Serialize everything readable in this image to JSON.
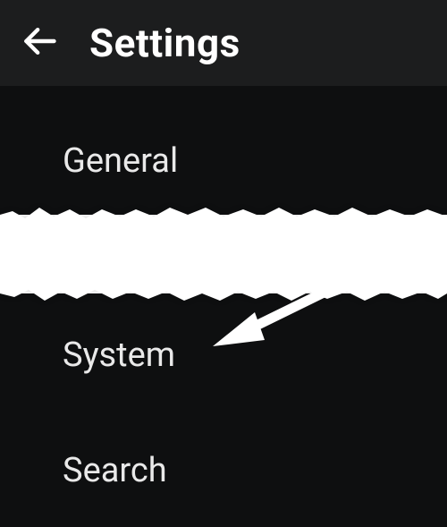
{
  "header": {
    "title": "Settings",
    "back_icon": "arrow-left"
  },
  "menu": {
    "items": [
      {
        "label": "General"
      },
      {
        "label": "System"
      },
      {
        "label": "Search"
      }
    ]
  }
}
